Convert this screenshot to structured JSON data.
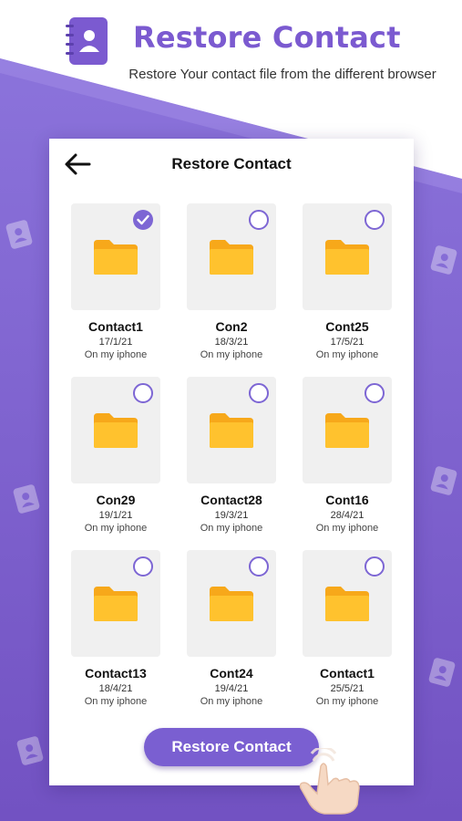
{
  "header": {
    "title": "Restore Contact",
    "subtitle": "Restore Your contact file from the different browser"
  },
  "colors": {
    "accent": "#7a5fd1",
    "title": "#7b5ad0",
    "folder": "#ffb81c"
  },
  "card": {
    "back_icon": "arrow-left-icon",
    "title": "Restore Contact",
    "items": [
      {
        "name": "Contact1",
        "date": "17/1/21",
        "location": "On my iphone",
        "selected": true
      },
      {
        "name": "Con2",
        "date": "18/3/21",
        "location": "On my iphone",
        "selected": false
      },
      {
        "name": "Cont25",
        "date": "17/5/21",
        "location": "On my iphone",
        "selected": false
      },
      {
        "name": "Con29",
        "date": "19/1/21",
        "location": "On my iphone",
        "selected": false
      },
      {
        "name": "Contact28",
        "date": "19/3/21",
        "location": "On my iphone",
        "selected": false
      },
      {
        "name": "Cont16",
        "date": "28/4/21",
        "location": "On my iphone",
        "selected": false
      },
      {
        "name": "Contact13",
        "date": "18/4/21",
        "location": "On my iphone",
        "selected": false
      },
      {
        "name": "Cont24",
        "date": "19/4/21",
        "location": "On my iphone",
        "selected": false
      },
      {
        "name": "Contact1",
        "date": "25/5/21",
        "location": "On my iphone",
        "selected": false
      }
    ],
    "restore_button": "Restore Contact"
  }
}
